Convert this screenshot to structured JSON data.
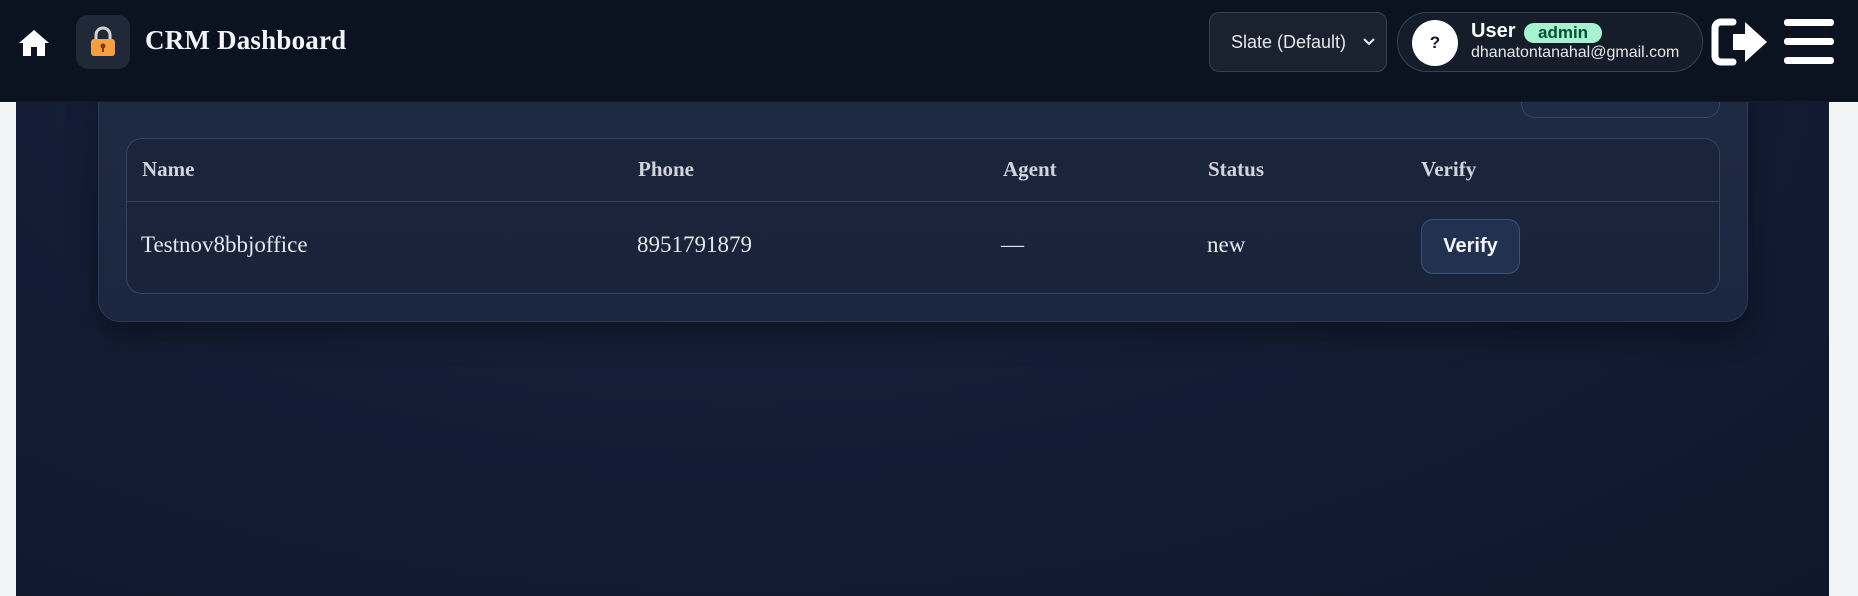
{
  "header": {
    "title": "CRM Dashboard",
    "theme_select": {
      "value": "Slate (Default)"
    },
    "user": {
      "avatar_text": "?",
      "name": "User",
      "role": "admin",
      "email": "dhanatontanahal@gmail.com"
    },
    "icons": [
      "home-icon",
      "lock-icon",
      "chevron-down-icon",
      "logout-icon",
      "menu-icon"
    ]
  },
  "table": {
    "columns": [
      "Name",
      "Phone",
      "Agent",
      "Status",
      "Verify"
    ],
    "rows": [
      {
        "name": "Testnov8bbjoffice",
        "phone": "8951791879",
        "agent": "—",
        "status": "new",
        "verify_label": "Verify"
      }
    ]
  },
  "colors": {
    "header_bg": "#0b1220",
    "card_bg": "#1f2a42",
    "badge_bg": "#a7f3d0"
  }
}
